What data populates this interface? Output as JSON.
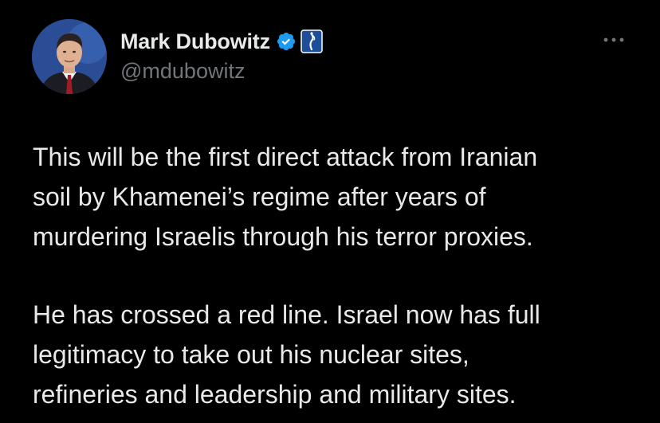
{
  "author": {
    "display_name": "Mark Dubowitz",
    "handle": "@mdubowitz",
    "verified_badge_color": "#1d9bf0",
    "affiliate_badge_color": "#1d4e9a"
  },
  "icons": {
    "avatar": "profile-photo",
    "verified": "verified-badge-icon",
    "affiliate": "affiliate-logo-icon",
    "more": "more-dots-icon"
  },
  "tweet": {
    "paragraphs": [
      {
        "lines": [
          "This will be the first direct attack from Iranian",
          "soil by Khamenei’s regime after years of",
          "murdering Israelis through his terror proxies."
        ]
      },
      {
        "lines": [
          "He has crossed a red line. Israel now has full",
          "legitimacy to take out his nuclear sites,",
          "refineries and leadership and military sites."
        ]
      }
    ]
  },
  "colors": {
    "background": "#000000",
    "text": "#e7e9ea",
    "secondary_text": "#71767b"
  }
}
